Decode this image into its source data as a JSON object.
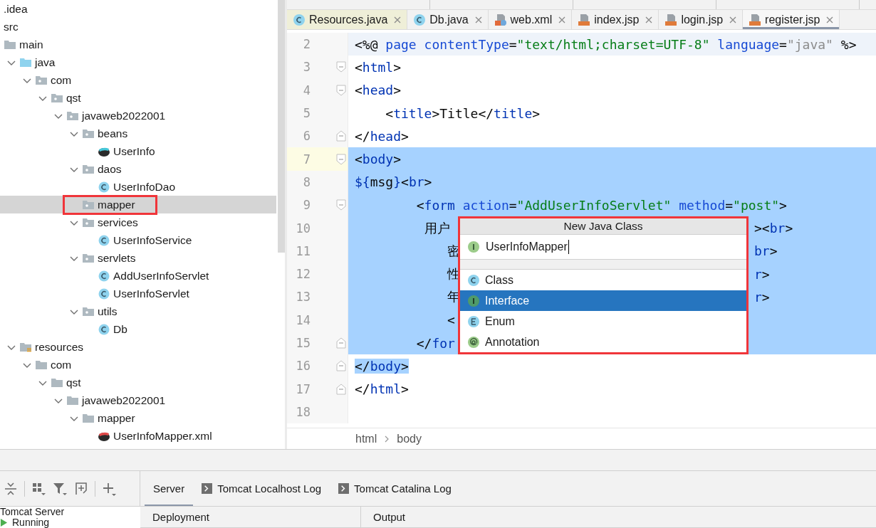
{
  "project_tree": {
    "items": [
      {
        "label": ".idea",
        "kind": "plain",
        "selected": false
      },
      {
        "label": "src",
        "kind": "plain",
        "selected": false
      },
      {
        "label": "main",
        "kind": "folder",
        "selected": false
      },
      {
        "label": "java",
        "kind": "source-folder",
        "expanded": true,
        "selected": false,
        "children": [
          {
            "label": "com",
            "kind": "package",
            "expanded": true,
            "selected": false,
            "children": [
              {
                "label": "qst",
                "kind": "package",
                "expanded": true,
                "selected": false,
                "children": [
                  {
                    "label": "javaweb2022001",
                    "kind": "package",
                    "expanded": true,
                    "selected": false,
                    "children": [
                      {
                        "label": "beans",
                        "kind": "package",
                        "expanded": true,
                        "selected": false,
                        "children": [
                          {
                            "label": "UserInfo",
                            "kind": "bean",
                            "selected": false
                          }
                        ]
                      },
                      {
                        "label": "daos",
                        "kind": "package",
                        "expanded": true,
                        "selected": false,
                        "children": [
                          {
                            "label": "UserInfoDao",
                            "kind": "class",
                            "selected": false
                          }
                        ]
                      },
                      {
                        "label": "mapper",
                        "kind": "package",
                        "selected": true,
                        "marked": true
                      },
                      {
                        "label": "services",
                        "kind": "package",
                        "expanded": true,
                        "selected": false,
                        "children": [
                          {
                            "label": "UserInfoService",
                            "kind": "class",
                            "selected": false
                          }
                        ]
                      },
                      {
                        "label": "servlets",
                        "kind": "package",
                        "expanded": true,
                        "selected": false,
                        "children": [
                          {
                            "label": "AddUserInfoServlet",
                            "kind": "class",
                            "selected": false
                          },
                          {
                            "label": "UserInfoServlet",
                            "kind": "class",
                            "selected": false
                          }
                        ]
                      },
                      {
                        "label": "utils",
                        "kind": "package",
                        "expanded": true,
                        "selected": false,
                        "children": [
                          {
                            "label": "Db",
                            "kind": "class",
                            "selected": false
                          }
                        ]
                      }
                    ]
                  }
                ]
              }
            ]
          }
        ]
      },
      {
        "label": "resources",
        "kind": "resources-folder",
        "expanded": true,
        "selected": false,
        "children": [
          {
            "label": "com",
            "kind": "folder",
            "expanded": true,
            "selected": false,
            "children": [
              {
                "label": "qst",
                "kind": "folder",
                "expanded": true,
                "selected": false,
                "children": [
                  {
                    "label": "javaweb2022001",
                    "kind": "folder",
                    "expanded": true,
                    "selected": false,
                    "children": [
                      {
                        "label": "mapper",
                        "kind": "folder",
                        "expanded": true,
                        "selected": false,
                        "children": [
                          {
                            "label": "UserInfoMapper.xml",
                            "kind": "mapper-xml",
                            "selected": false
                          }
                        ]
                      }
                    ]
                  }
                ]
              }
            ]
          }
        ]
      }
    ]
  },
  "editor": {
    "tabs": [
      {
        "label": "Resources.java",
        "kind": "class",
        "selected": false,
        "tinted": true
      },
      {
        "label": "Db.java",
        "kind": "class",
        "selected": false,
        "tinted": false
      },
      {
        "label": "web.xml",
        "kind": "xml",
        "selected": false,
        "tinted": false
      },
      {
        "label": "index.jsp",
        "kind": "jsp",
        "selected": false,
        "tinted": false
      },
      {
        "label": "login.jsp",
        "kind": "jsp",
        "selected": false,
        "tinted": false
      },
      {
        "label": "register.jsp",
        "kind": "jsp",
        "selected": true,
        "tinted": false
      }
    ],
    "lines": [
      {
        "number": "2",
        "shaded": true,
        "tokens": [
          {
            "t": "<%@ ",
            "kind": "plain"
          },
          {
            "t": "page contentType",
            "kind": "attr"
          },
          {
            "t": "=",
            "kind": "plain"
          },
          {
            "t": "\"text/html;charset=UTF-8\"",
            "kind": "value"
          },
          {
            "t": " language",
            "kind": "attr"
          },
          {
            "t": "=",
            "kind": "plain"
          },
          {
            "t": "\"java\"",
            "kind": "gray"
          },
          {
            "t": " %>",
            "kind": "plain"
          }
        ]
      },
      {
        "number": "3",
        "fold": {
          "kind": "start"
        },
        "tokens": [
          {
            "t": "<",
            "kind": "plain"
          },
          {
            "t": "html",
            "kind": "tag"
          },
          {
            "t": ">",
            "kind": "plain"
          }
        ]
      },
      {
        "number": "4",
        "fold": {
          "kind": "start"
        },
        "tokens": [
          {
            "t": "<",
            "kind": "plain"
          },
          {
            "t": "head",
            "kind": "tag"
          },
          {
            "t": ">",
            "kind": "plain"
          }
        ]
      },
      {
        "number": "5",
        "tokens": [
          {
            "t": "    <",
            "kind": "plain"
          },
          {
            "t": "title",
            "kind": "tag"
          },
          {
            "t": ">Title</",
            "kind": "plain"
          },
          {
            "t": "title",
            "kind": "tag"
          },
          {
            "t": ">",
            "kind": "plain"
          }
        ]
      },
      {
        "number": "6",
        "fold": {
          "kind": "end"
        },
        "tokens": [
          {
            "t": "</",
            "kind": "plain"
          },
          {
            "t": "head",
            "kind": "tag"
          },
          {
            "t": ">",
            "kind": "plain"
          }
        ]
      },
      {
        "number": "7",
        "fold": {
          "kind": "start"
        },
        "caret": true,
        "selection": {
          "kind": "full"
        },
        "tokens": [
          {
            "t": "<",
            "kind": "plain"
          },
          {
            "t": "body",
            "kind": "tag"
          },
          {
            "t": ">",
            "kind": "plain"
          }
        ]
      },
      {
        "number": "8",
        "selection": {
          "kind": "full"
        },
        "tokens": [
          {
            "t": "${",
            "kind": "tag"
          },
          {
            "t": "msg",
            "kind": "plain"
          },
          {
            "t": "}",
            "kind": "tag"
          },
          {
            "t": "<",
            "kind": "plain"
          },
          {
            "t": "br",
            "kind": "tag"
          },
          {
            "t": ">",
            "kind": "plain"
          }
        ]
      },
      {
        "number": "9",
        "fold": {
          "kind": "start"
        },
        "selection": {
          "kind": "full"
        },
        "tokens": [
          {
            "t": "        <",
            "kind": "plain"
          },
          {
            "t": "form",
            "kind": "tag"
          },
          {
            "t": " action",
            "kind": "attr"
          },
          {
            "t": "=",
            "kind": "plain"
          },
          {
            "t": "\"AddUserInfoServlet\"",
            "kind": "value"
          },
          {
            "t": " method",
            "kind": "attr"
          },
          {
            "t": "=",
            "kind": "plain"
          },
          {
            "t": "\"post\"",
            "kind": "value"
          },
          {
            "t": ">",
            "kind": "plain"
          }
        ]
      },
      {
        "number": "10",
        "selection": {
          "kind": "full"
        },
        "tokens": [
          {
            "t": "         用户",
            "kind": "plain"
          }
        ],
        "right": [
          {
            "t": "><",
            "kind": "plain"
          },
          {
            "t": "br",
            "kind": "tag"
          },
          {
            "t": ">",
            "kind": "plain"
          }
        ]
      },
      {
        "number": "11",
        "selection": {
          "kind": "full"
        },
        "tokens": [
          {
            "t": "            密",
            "kind": "plain"
          }
        ],
        "right": [
          {
            "t": "br",
            "kind": "tag"
          },
          {
            "t": ">",
            "kind": "plain"
          }
        ]
      },
      {
        "number": "12",
        "selection": {
          "kind": "full"
        },
        "tokens": [
          {
            "t": "            性",
            "kind": "plain"
          }
        ],
        "right": [
          {
            "t": "r",
            "kind": "tag"
          },
          {
            "t": ">",
            "kind": "plain"
          }
        ]
      },
      {
        "number": "13",
        "selection": {
          "kind": "full"
        },
        "tokens": [
          {
            "t": "            年",
            "kind": "plain"
          }
        ],
        "right": [
          {
            "t": "r",
            "kind": "tag"
          },
          {
            "t": ">",
            "kind": "plain"
          }
        ]
      },
      {
        "number": "14",
        "selection": {
          "kind": "full"
        },
        "tokens": [
          {
            "t": "            <",
            "kind": "plain"
          }
        ]
      },
      {
        "number": "15",
        "fold": {
          "kind": "end"
        },
        "selection": {
          "kind": "full"
        },
        "tokens": [
          {
            "t": "        </",
            "kind": "plain"
          },
          {
            "t": "for",
            "kind": "tag"
          }
        ]
      },
      {
        "number": "16",
        "fold": {
          "kind": "end"
        },
        "selection": {
          "kind": "text"
        },
        "tokens": [
          {
            "t": "</",
            "kind": "plain"
          },
          {
            "t": "body",
            "kind": "tag"
          },
          {
            "t": ">",
            "kind": "plain"
          }
        ]
      },
      {
        "number": "17",
        "fold": {
          "kind": "end"
        },
        "tokens": [
          {
            "t": "</",
            "kind": "plain"
          },
          {
            "t": "html",
            "kind": "tag"
          },
          {
            "t": ">",
            "kind": "plain"
          }
        ]
      },
      {
        "number": "18"
      }
    ],
    "breadcrumbs": [
      "html",
      "body"
    ]
  },
  "new_class_popup": {
    "title": "New Java Class",
    "marked": true,
    "name_field": {
      "value": "UserInfoMapper",
      "kind": "interface"
    },
    "options": [
      {
        "label": "Class",
        "kind": "class",
        "selected": false
      },
      {
        "label": "Interface",
        "kind": "interface",
        "selected": true
      },
      {
        "label": "Enum",
        "kind": "enum",
        "selected": false
      },
      {
        "label": "Annotation",
        "kind": "annotation",
        "selected": false
      }
    ]
  },
  "services_panel": {
    "toolbar": [
      {
        "kind": "collapse"
      },
      {
        "kind": "group"
      },
      {
        "kind": "filter"
      },
      {
        "kind": "new-frame"
      },
      {
        "kind": "add"
      }
    ],
    "tabs": [
      {
        "label": "Server",
        "kind": "plain",
        "selected": true
      },
      {
        "label": "Tomcat Localhost Log",
        "kind": "log",
        "selected": false
      },
      {
        "label": "Tomcat Catalina Log",
        "kind": "log",
        "selected": false
      }
    ],
    "tree": [
      {
        "label": "Tomcat Server",
        "kind": "server"
      },
      {
        "label": "Running",
        "kind": "running"
      }
    ],
    "columns": [
      "Deployment",
      "Output"
    ]
  }
}
